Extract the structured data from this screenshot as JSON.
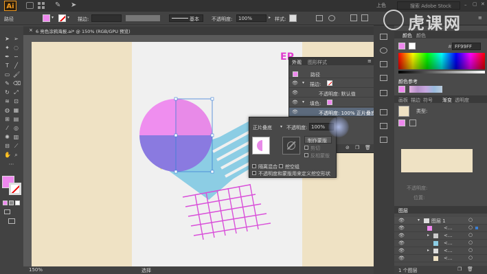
{
  "app": {
    "logo": "Ai",
    "search_placeholder": "搜索 Adobe Stock",
    "workspace": "上色"
  },
  "control_bar": {
    "selection_label": "路径",
    "stroke_label": "描边:",
    "style_label": "基本",
    "opacity_label": "不透明度:",
    "opacity_value": "100%",
    "style2_label": "样式:"
  },
  "document_tab": {
    "title": "6 亮色涂鸦海报.ai* @ 150% (RGB/GPU 预览)",
    "close": "×"
  },
  "status_bar": {
    "zoom": "150%",
    "tool": "选择"
  },
  "appearance_panel": {
    "tabs": [
      "外观",
      "图形样式"
    ],
    "object": "路径",
    "stroke_label": "描边:",
    "stroke_opacity": "不透明度: 默认值",
    "fill_label": "填色:",
    "fill_opacity": "不透明度: 100% 正片叠底",
    "fx": "fx"
  },
  "transparency_panel": {
    "blend_mode": "正片叠底",
    "opacity_label": "不透明度:",
    "opacity_value": "100%",
    "make_mask": "制作蒙版",
    "clip": "剪切",
    "invert_mask": "反相蒙版",
    "isolate_blending": "隔离混合",
    "knockout_group": "挖空组",
    "opacity_mask_knockout": "不透明度和蒙版用来定义挖空形状"
  },
  "right_panel": {
    "color_tab": "颜色",
    "color_tab2": "颜色",
    "hex_value": "FF99FF",
    "color_guide": "颜色参考",
    "gradient_tabs": [
      "画板",
      "描边",
      "符号",
      "渐变",
      "透明度"
    ],
    "gradient_type_label": "类型:",
    "opacity_label": "不透明度:",
    "location_label": "位置:",
    "layers_title": "图层",
    "layer_name": "图层 1",
    "sublayers": [
      "<...",
      "<...",
      "<...",
      "<...",
      "<...",
      "<..."
    ],
    "layers_count": "1 个图层"
  },
  "watermark": {
    "text": "虎课网"
  },
  "colors": {
    "fill": "#ee88ee",
    "accent": "#e85de8",
    "cream": "#efe2c4"
  }
}
